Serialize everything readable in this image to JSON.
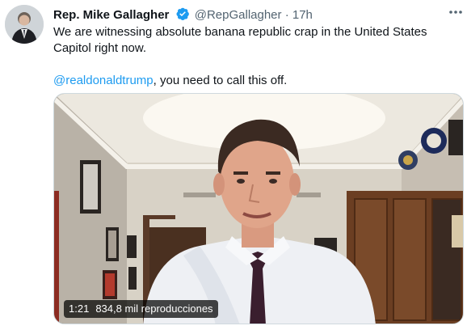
{
  "tweet": {
    "author_name": "Rep. Mike Gallagher",
    "handle": "@RepGallagher",
    "separator": "·",
    "time": "17h",
    "line1": "We are witnessing absolute banana republic crap in the United States Capitol right now.",
    "mention": "@realdonaldtrump",
    "line2_rest": ", you need to call this off."
  },
  "icons": {
    "verified": "verified-badge-icon",
    "more": "more-options-icon"
  },
  "video": {
    "duration": "1:21",
    "views": "834,8 mil reproducciones"
  },
  "colors": {
    "link": "#1d9bf0",
    "verified": "#1d9bf0",
    "meta": "#536471"
  }
}
